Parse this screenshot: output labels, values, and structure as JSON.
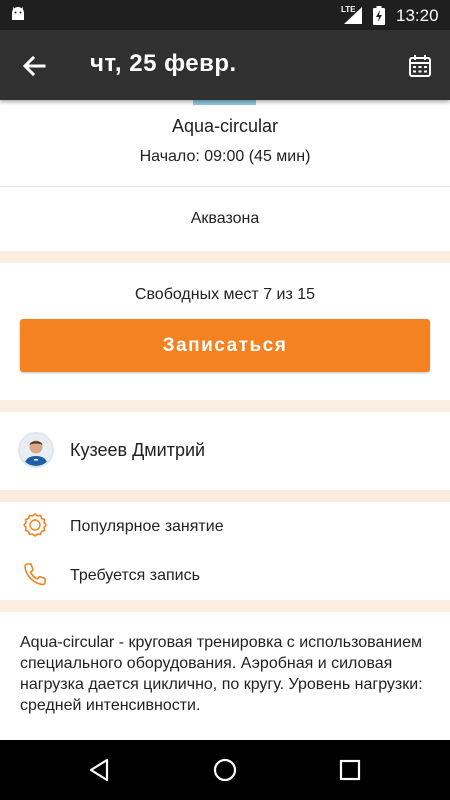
{
  "status_bar": {
    "network": "LTE",
    "time": "13:20",
    "icons": [
      "android-icon",
      "signal-icon",
      "battery-charging-icon"
    ]
  },
  "app_bar": {
    "title": "чт, 25 февр.",
    "back_icon": "arrow-left-icon",
    "calendar_icon": "calendar-icon"
  },
  "class_info": {
    "name": "Aqua-circular",
    "time": "Начало: 09:00 (45 мин)",
    "location": "Аквазона",
    "accent_color": "#8dcde6"
  },
  "booking": {
    "free_spots": "Свободных мест 7 из 15",
    "button_label": "Записаться",
    "button_color": "#f48220"
  },
  "trainer": {
    "name": "Кузеев Дмитрий"
  },
  "features": [
    {
      "icon": "badge-icon",
      "label": "Популярное занятие"
    },
    {
      "icon": "phone-icon",
      "label": "Требуется запись"
    }
  ],
  "description": "Aqua-circular - круговая тренировка с использованием специального оборудования. Аэробная и силовая нагрузка дается циклично, по кругу. Уровень нагрузки: средней интенсивности.",
  "nav_bar": [
    "back-triangle-icon",
    "home-circle-icon",
    "recents-square-icon"
  ],
  "colors": {
    "app_bar": "#303030",
    "separator": "#fbeee0",
    "accent_orange": "#f48220"
  }
}
